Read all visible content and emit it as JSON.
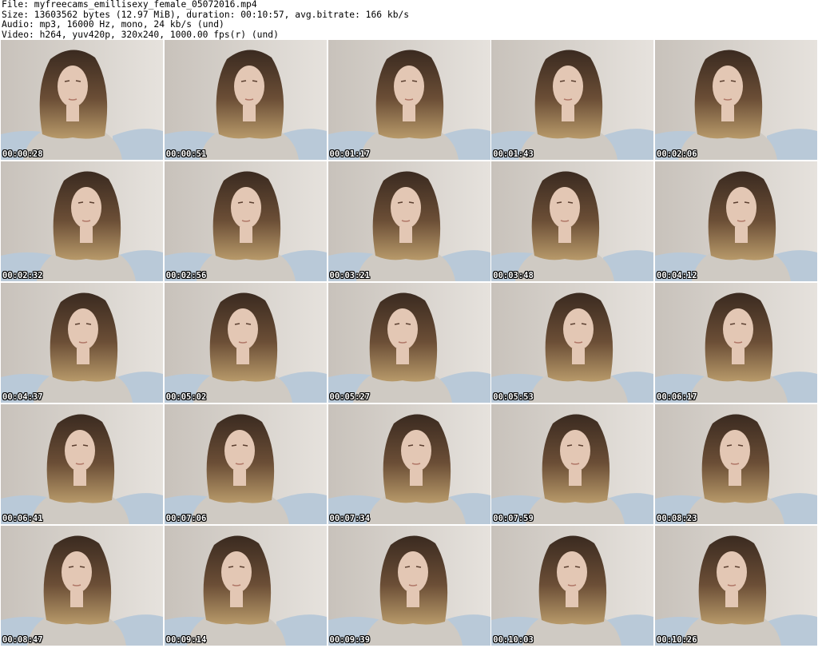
{
  "header": {
    "file_line": "File: myfreecams_emillisexy_female_05072016.mp4",
    "size_line": "Size: 13603562 bytes (12.97 MiB), duration: 00:10:57, avg.bitrate: 166 kb/s",
    "audio_line": "Audio: mp3, 16000 Hz, mono, 24 kb/s (und)",
    "video_line": "Video: h264, yuv420p, 320x240, 1000.00 fps(r) (und)"
  },
  "grid": {
    "columns": 5,
    "rows": 5,
    "timestamps": [
      "00:00:28",
      "00:00:51",
      "00:01:17",
      "00:01:43",
      "00:02:06",
      "00:02:32",
      "00:02:56",
      "00:03:21",
      "00:03:48",
      "00:04:12",
      "00:04:37",
      "00:05:02",
      "00:05:27",
      "00:05:53",
      "00:06:17",
      "00:06:41",
      "00:07:06",
      "00:07:34",
      "00:07:59",
      "00:08:23",
      "00:08:47",
      "00:09:14",
      "00:09:39",
      "00:10:03",
      "00:10:26"
    ]
  },
  "colors": {
    "wall": "#d6d1cb",
    "sofa": "#b9c9d8",
    "hair_dark": "#3a2a20",
    "hair_light": "#b89a6a",
    "skin": "#e3c7b4",
    "shirt": "#cfcac3",
    "timestamp_text": "#ffffff",
    "timestamp_outline": "#000000"
  }
}
